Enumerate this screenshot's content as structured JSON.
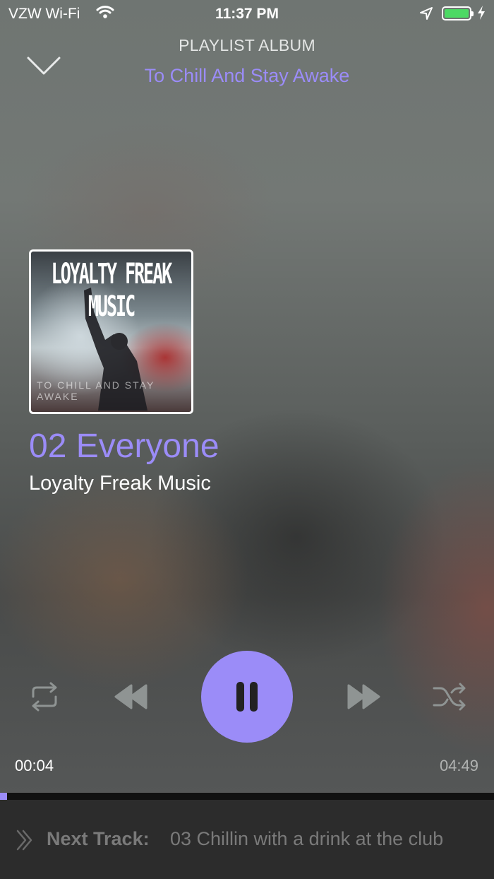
{
  "status_bar": {
    "carrier": "VZW Wi-Fi",
    "time": "11:37 PM",
    "battery_level": 1.0
  },
  "header": {
    "subtitle": "PLAYLIST ALBUM",
    "title": "To Chill And Stay Awake"
  },
  "album_art": {
    "title_text": "LOYALTY FREAK MUSIC",
    "subtitle_text": "TO CHILL AND STAY AWAKE"
  },
  "track": {
    "title": "02 Everyone",
    "artist": "Loyalty Freak Music"
  },
  "playback": {
    "current_time": "00:04",
    "total_time": "04:49",
    "progress": 0.014
  },
  "next_track": {
    "label": "Next Track:",
    "title": "03 Chillin with a drink at the club"
  },
  "icons": {
    "collapse": "chevron-down-icon",
    "repeat": "repeat-icon",
    "rewind": "rewind-icon",
    "pause": "pause-icon",
    "forward": "fast-forward-icon",
    "shuffle": "shuffle-icon",
    "next": "double-chevron-right-icon"
  },
  "colors": {
    "accent": "#9b8cf8",
    "battery": "#4cd964",
    "next_bar_bg": "#2c2c2c"
  }
}
